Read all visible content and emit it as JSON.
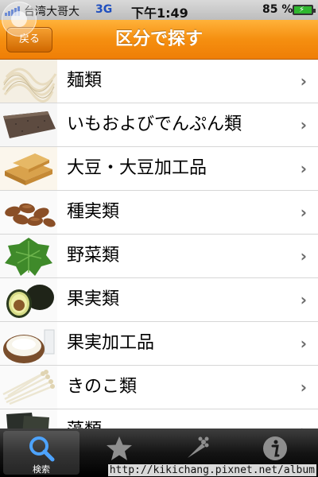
{
  "status_bar": {
    "carrier": "台湾大哥大",
    "network": "3G",
    "time": "下午1:49",
    "battery": "85 %"
  },
  "nav": {
    "back_label": "戻る",
    "title": "区分で探す"
  },
  "categories": [
    {
      "label": "麺類",
      "icon": "noodles-image"
    },
    {
      "label": "いもおよびでんぷん類",
      "icon": "konjac-image"
    },
    {
      "label": "大豆・大豆加工品",
      "icon": "fried-tofu-image"
    },
    {
      "label": "種実類",
      "icon": "almonds-image"
    },
    {
      "label": "野菜類",
      "icon": "shiso-leaf-image"
    },
    {
      "label": "果実類",
      "icon": "avocado-image"
    },
    {
      "label": "果実加工品",
      "icon": "coconut-image"
    },
    {
      "label": "きのこ類",
      "icon": "enoki-mushroom-image"
    },
    {
      "label": "藻類",
      "icon": "seaweed-image"
    }
  ],
  "chevron": "›",
  "tabs": [
    {
      "label": "検索",
      "icon": "search-icon",
      "active": true
    },
    {
      "label": "",
      "icon": "star-icon",
      "active": false
    },
    {
      "label": "",
      "icon": "vegetables-icon",
      "active": false
    },
    {
      "label": "",
      "icon": "info-icon",
      "active": false
    }
  ],
  "watermark": "http://kikichang.pixnet.net/album",
  "colors": {
    "nav_orange": "#f58f10",
    "tab_bar": "#141414",
    "accent_blue": "#1f4fbf"
  }
}
